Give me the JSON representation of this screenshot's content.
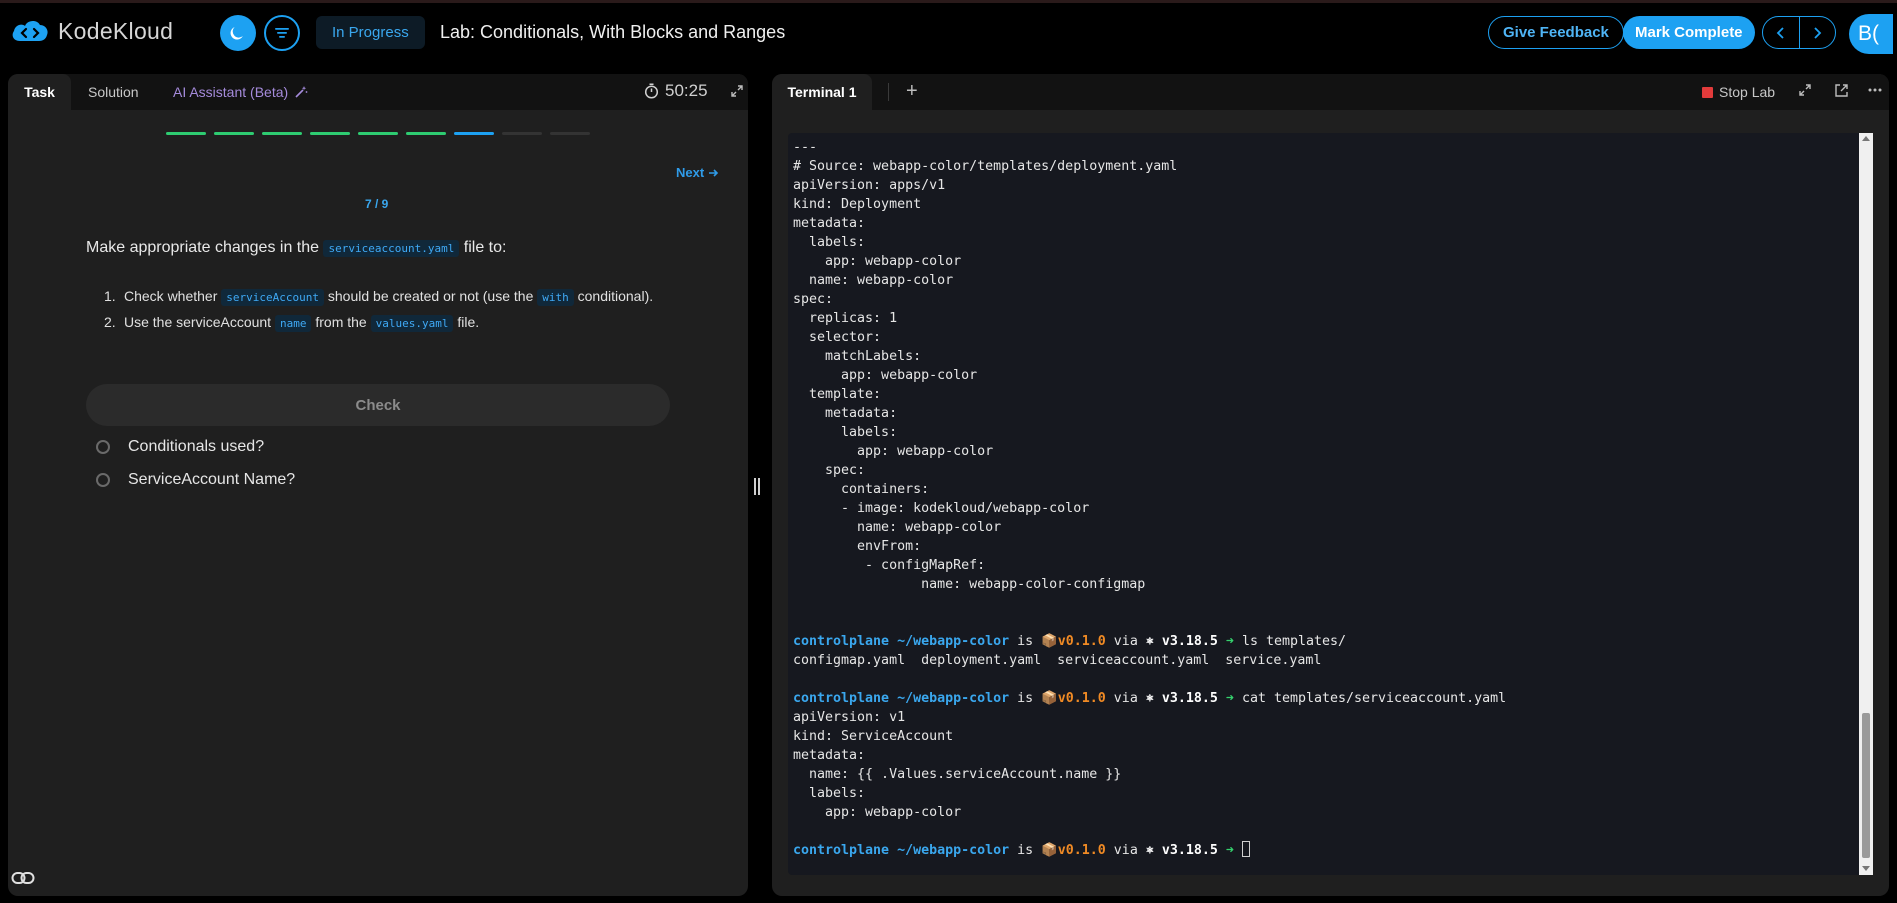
{
  "header": {
    "logo_text": "KodeKloud",
    "status": "In Progress",
    "lab_title": "Lab: Conditionals, With Blocks and Ranges",
    "feedback_label": "Give Feedback",
    "complete_label": "Mark Complete",
    "avatar_initials": "B(",
    "accent_color": "#1da1f2"
  },
  "left_panel": {
    "tabs": [
      {
        "label": "Task",
        "active": true
      },
      {
        "label": "Solution",
        "active": false
      },
      {
        "label": "AI Assistant (Beta)",
        "active": false
      }
    ],
    "timer": "50:25",
    "progress_segments": [
      {
        "state": "done",
        "color": "#2ecc71"
      },
      {
        "state": "done",
        "color": "#2ecc71"
      },
      {
        "state": "done",
        "color": "#2ecc71"
      },
      {
        "state": "done",
        "color": "#2ecc71"
      },
      {
        "state": "done",
        "color": "#2ecc71"
      },
      {
        "state": "done",
        "color": "#2ecc71"
      },
      {
        "state": "current",
        "color": "#1da1f2"
      },
      {
        "state": "pending",
        "color": "#333333"
      },
      {
        "state": "pending",
        "color": "#333333"
      }
    ],
    "next_label": "Next",
    "step_counter": "7 / 9",
    "task": {
      "intro_before": "Make appropriate changes in the ",
      "intro_code": "serviceaccount.yaml",
      "intro_after": " file to:",
      "items": [
        {
          "num": "1.",
          "t1": "Check whether ",
          "c1": "serviceAccount",
          "t2": " should be created or not (use the ",
          "c2": "with",
          "t3": " conditional)."
        },
        {
          "num": "2.",
          "t1": "Use the serviceAccount ",
          "c1": "name",
          "t2": " from the ",
          "c2": "values.yaml",
          "t3": " file."
        }
      ]
    },
    "check_label": "Check",
    "checks": [
      {
        "label": "Conditionals used?"
      },
      {
        "label": "ServiceAccount Name?"
      }
    ]
  },
  "right_panel": {
    "tab_label": "Terminal 1",
    "add_tab": "+",
    "stop_label": "Stop Lab",
    "prompt": {
      "user": "controlplane",
      "dir": "~/webapp-color",
      "is": "is",
      "pkg_icon": "📦",
      "version": "v0.1.0",
      "via": "via",
      "k8s_icon": "⎈",
      "k8s_version": "v3.18.5",
      "arrow": "➜"
    },
    "terminal_output": [
      "---",
      "# Source: webapp-color/templates/deployment.yaml",
      "apiVersion: apps/v1",
      "kind: Deployment",
      "metadata:",
      "  labels:",
      "    app: webapp-color",
      "  name: webapp-color",
      "spec:",
      "  replicas: 1",
      "  selector:",
      "    matchLabels:",
      "      app: webapp-color",
      "  template:",
      "    metadata:",
      "      labels:",
      "        app: webapp-color",
      "    spec:",
      "      containers:",
      "      - image: kodekloud/webapp-color",
      "        name: webapp-color",
      "        envFrom:",
      "         - configMapRef:",
      "                name: webapp-color-configmap",
      "",
      "",
      {
        "prompt": true,
        "cmd": "ls templates/"
      },
      "configmap.yaml  deployment.yaml  serviceaccount.yaml  service.yaml",
      "",
      {
        "prompt": true,
        "cmd": "cat templates/serviceaccount.yaml"
      },
      "apiVersion: v1",
      "kind: ServiceAccount",
      "metadata:",
      "  name: {{ .Values.serviceAccount.name }}",
      "  labels:",
      "    app: webapp-color",
      "",
      {
        "prompt": true,
        "cmd": "",
        "cursor": true
      }
    ]
  }
}
